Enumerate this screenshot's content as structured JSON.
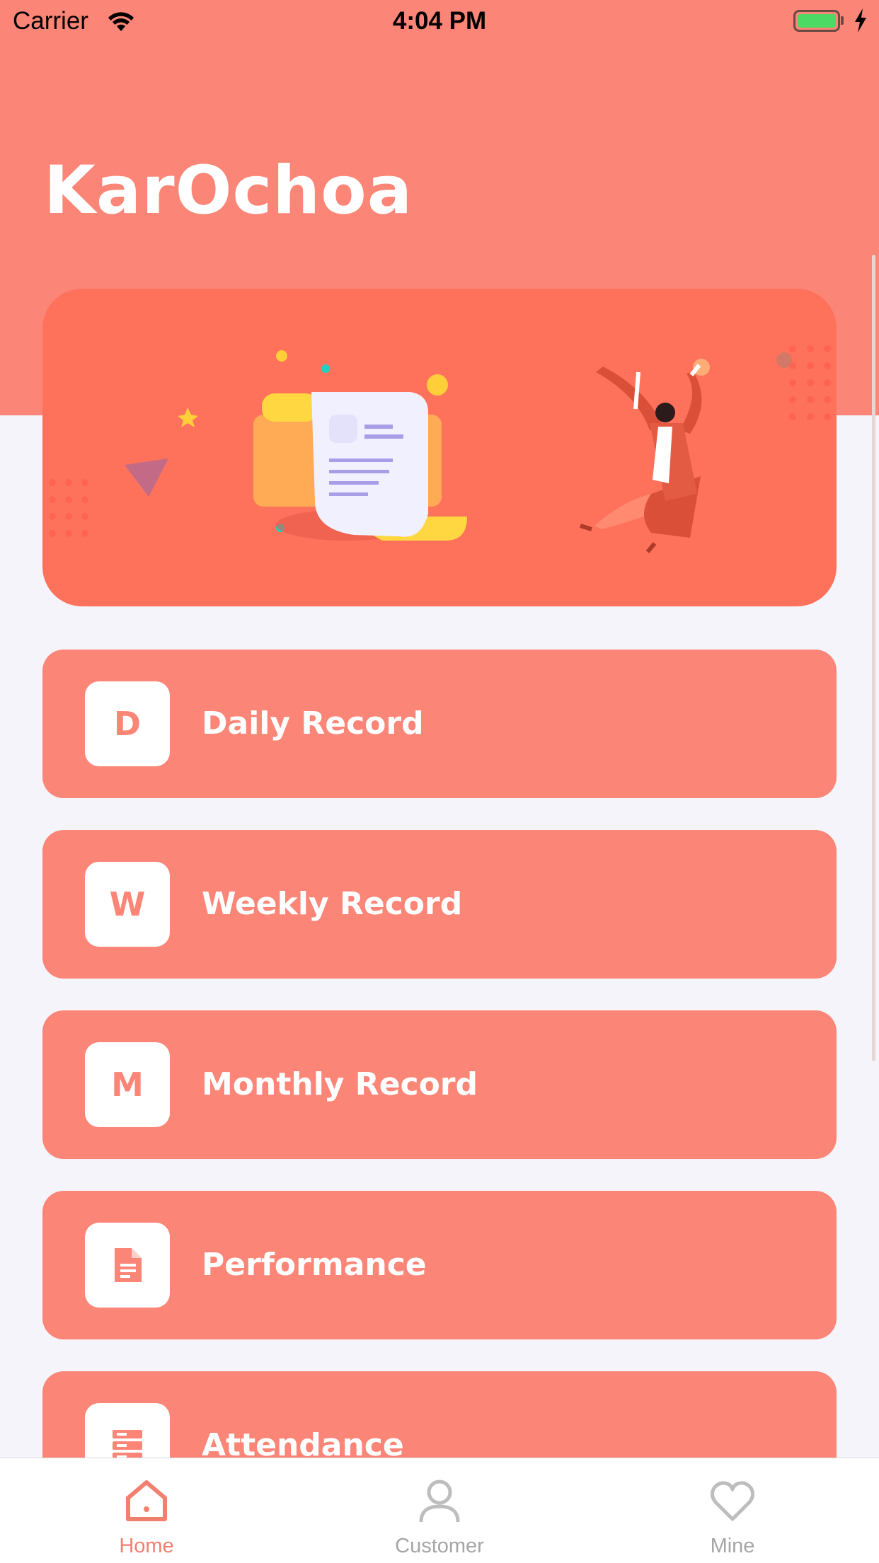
{
  "status_bar": {
    "carrier": "Carrier",
    "time": "4:04 PM"
  },
  "header": {
    "title": "KarOchoa"
  },
  "menu": [
    {
      "icon_text": "D",
      "label": "Daily Record",
      "icon": "letter-d"
    },
    {
      "icon_text": "W",
      "label": "Weekly Record",
      "icon": "letter-w"
    },
    {
      "icon_text": "M",
      "label": "Monthly Record",
      "icon": "letter-m"
    },
    {
      "icon_text": "",
      "label": "Performance",
      "icon": "document-icon"
    },
    {
      "icon_text": "",
      "label": "Attendance",
      "icon": "server-icon"
    }
  ],
  "tabs": [
    {
      "label": "Home",
      "icon": "home-icon",
      "active": true
    },
    {
      "label": "Customer",
      "icon": "person-icon",
      "active": false
    },
    {
      "label": "Mine",
      "icon": "heart-icon",
      "active": false
    }
  ],
  "colors": {
    "accent": "#fb8576",
    "banner": "#fe725c",
    "background": "#f4f4fa"
  }
}
